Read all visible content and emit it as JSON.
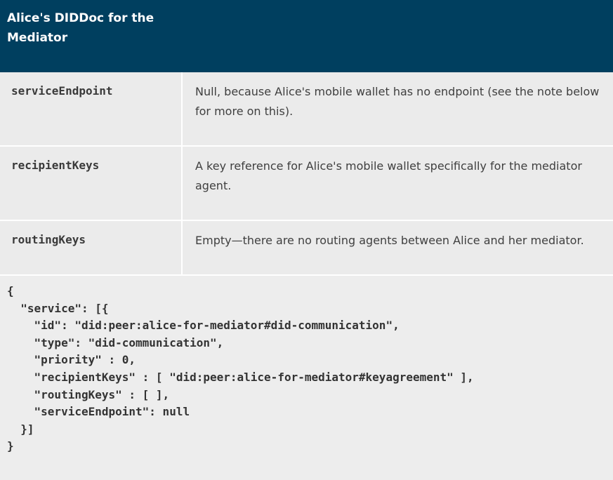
{
  "header": {
    "title": "Alice's DIDDoc for the Mediator"
  },
  "table": {
    "rows": [
      {
        "key": "serviceEndpoint",
        "description": "Null, because Alice's mobile wallet has no endpoint (see the note below for more on this)."
      },
      {
        "key": "recipientKeys",
        "description": "A key reference for Alice's mobile wallet specifically for the mediator agent."
      },
      {
        "key": "routingKeys",
        "description": "Empty—there are no routing agents between Alice and her mediator."
      }
    ]
  },
  "code": {
    "text": "{\n  \"service\": [{\n    \"id\": \"did:peer:alice-for-mediator#did-communication\",\n    \"type\": \"did-communication\",\n    \"priority\" : 0,\n    \"recipientKeys\" : [ \"did:peer:alice-for-mediator#keyagreement\" ],\n    \"routingKeys\" : [ ],\n    \"serviceEndpoint\": null\n  }]\n}"
  },
  "colors": {
    "header_bg": "#003f5f",
    "cell_bg": "#ebebeb",
    "code_bg": "#ededed"
  }
}
